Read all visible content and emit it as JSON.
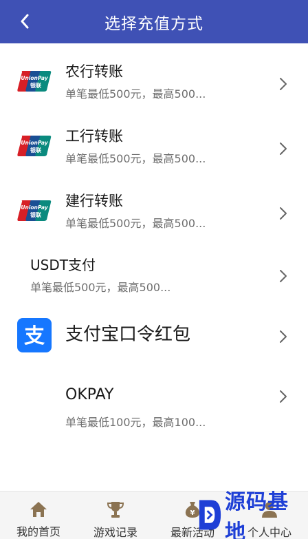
{
  "header": {
    "title": "选择充值方式"
  },
  "methods": [
    {
      "name": "农行转账",
      "desc": "单笔最低500元，最高500...",
      "icon": "unionpay-icon"
    },
    {
      "name": "工行转账",
      "desc": "单笔最低500元，最高500...",
      "icon": "unionpay-icon"
    },
    {
      "name": "建行转账",
      "desc": "单笔最低500元，最高500...",
      "icon": "unionpay-icon"
    },
    {
      "name": "USDT支付",
      "desc": "单笔最低500元，最高500..."
    },
    {
      "name": "支付宝口令红包",
      "icon": "alipay-icon"
    },
    {
      "name": "OKPAY",
      "desc": "单笔最低100元，最高100..."
    }
  ],
  "tabs": [
    {
      "label": "我的首页",
      "icon": "home-icon"
    },
    {
      "label": "游戏记录",
      "icon": "trophy-icon"
    },
    {
      "label": "最新活动",
      "icon": "money-bag-icon"
    },
    {
      "label": "个人中心",
      "icon": "user-icon"
    }
  ],
  "watermark": {
    "text": "源码基地"
  },
  "colors": {
    "header_bg": "#3f51b5",
    "alipay_blue": "#1677ff",
    "watermark_blue": "#1e3fd6"
  }
}
